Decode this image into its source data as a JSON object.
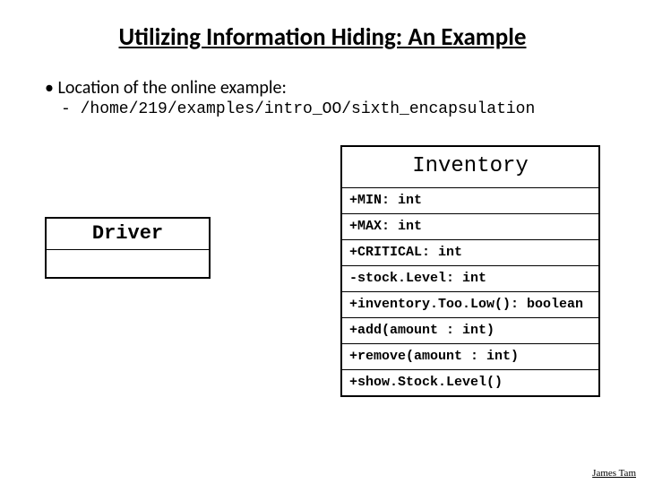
{
  "title": "Utilizing Information Hiding: An Example",
  "bullet": "• Location of the online example:",
  "path": "- /home/219/examples/intro_OO/sixth_encapsulation",
  "driver": {
    "name": "Driver"
  },
  "inventory": {
    "name": "Inventory",
    "rows": [
      "+MIN: int",
      "+MAX: int",
      "+CRITICAL: int",
      "-stock.Level: int",
      "+inventory.Too.Low(): boolean",
      "+add(amount : int)",
      "+remove(amount : int)",
      "+show.Stock.Level()"
    ]
  },
  "attribution": "James Tam"
}
